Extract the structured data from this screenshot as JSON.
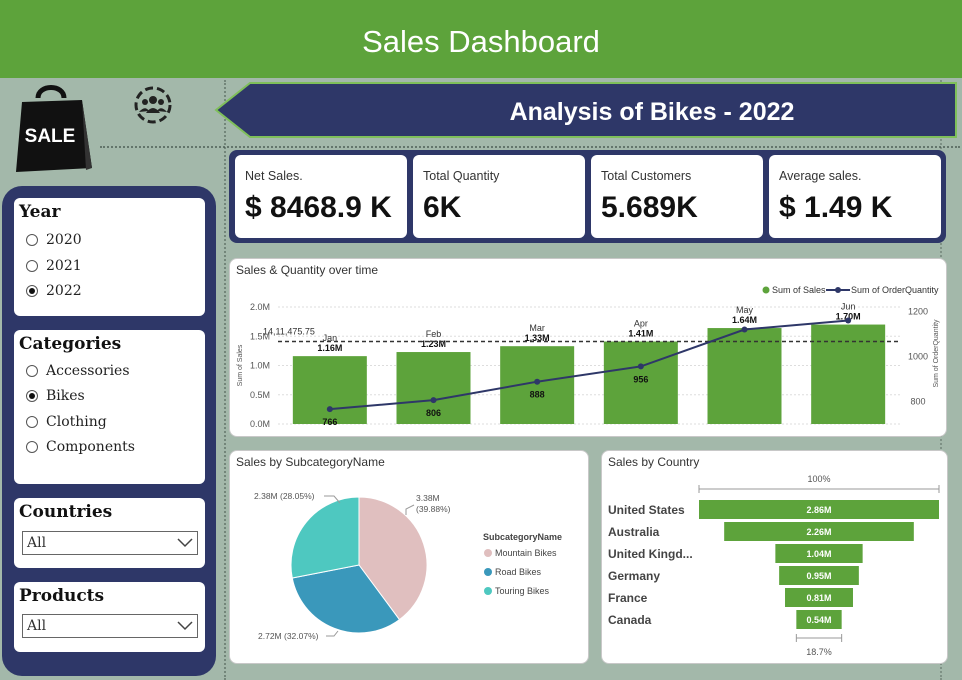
{
  "header": {
    "title": "Sales Dashboard"
  },
  "banner": {
    "text": "Analysis of Bikes - 2022"
  },
  "icons": {
    "logo": "sale-bag-icon",
    "logo_text": "SALE",
    "users": "people-group-icon"
  },
  "slicers": {
    "year": {
      "title": "Year",
      "options": [
        "2020",
        "2021",
        "2022"
      ],
      "selected": "2022"
    },
    "categories": {
      "title": "Categories",
      "options": [
        "Accessories",
        "Bikes",
        "Clothing",
        "Components"
      ],
      "selected": "Bikes"
    },
    "countries": {
      "title": "Countries",
      "value": "All"
    },
    "products": {
      "title": "Products",
      "value": "All"
    }
  },
  "kpis": [
    {
      "label": "Net Sales.",
      "value": "$ 8468.9 K"
    },
    {
      "label": "Total Quantity",
      "value": "6K"
    },
    {
      "label": "Total Customers",
      "value": "5.689K"
    },
    {
      "label": "Average sales.",
      "value": "$ 1.49 K"
    }
  ],
  "colors": {
    "green": "#5da33b",
    "navy": "#2e3768",
    "pink": "#e0bfbf",
    "blue": "#3a98bb",
    "teal": "#4ec8c0"
  },
  "chart_data": [
    {
      "type": "bar",
      "title": "Sales & Quantity over time",
      "categories": [
        "Jan",
        "Feb",
        "Mar",
        "Apr",
        "May",
        "Jun"
      ],
      "series": [
        {
          "name": "Sum of Sales",
          "type": "bar",
          "values": [
            1.16,
            1.23,
            1.33,
            1.41,
            1.64,
            1.7
          ],
          "labels": [
            "1.16M",
            "1.23M",
            "1.33M",
            "1.41M",
            "1.64M",
            "1.70M"
          ]
        },
        {
          "name": "Sum of OrderQuantity",
          "type": "line",
          "values": [
            766,
            806,
            888,
            956,
            1120,
            1160
          ],
          "labels": [
            "766",
            "806",
            "888",
            "956",
            "",
            ""
          ]
        }
      ],
      "reference_line": {
        "value": 1.41,
        "label": "14,11,475.75"
      },
      "ylabel": "Sum of Sales",
      "y2label": "Sum of OrderQuantity",
      "y_ticks": [
        "0.0M",
        "0.5M",
        "1.0M",
        "1.5M",
        "2.0M"
      ],
      "ylim": [
        0,
        2.0
      ],
      "y2_ticks": [
        "800",
        "1000",
        "1200"
      ],
      "y2lim": [
        700,
        1220
      ],
      "legend": "top-right"
    },
    {
      "type": "pie",
      "title": "Sales by SubcategoryName",
      "legend_title": "SubcategoryName",
      "labels": [
        "Mountain Bikes",
        "Road Bikes",
        "Touring Bikes"
      ],
      "values": [
        3.38,
        2.72,
        2.38
      ],
      "percent": [
        39.88,
        32.07,
        28.05
      ],
      "slice_labels": [
        "3.38M (39.88%)",
        "2.72M (32.07%)",
        "2.38M (28.05%)"
      ],
      "legend": "right"
    },
    {
      "type": "bar",
      "title": "Sales by Country",
      "categories": [
        "United States",
        "Australia",
        "United Kingd...",
        "Germany",
        "France",
        "Canada"
      ],
      "values": [
        2.86,
        2.26,
        1.04,
        0.95,
        0.81,
        0.54
      ],
      "labels": [
        "2.86M",
        "2.26M",
        "1.04M",
        "0.95M",
        "0.81M",
        "0.54M"
      ],
      "top_percent": "100%",
      "bottom_percent": "18.7%"
    }
  ]
}
